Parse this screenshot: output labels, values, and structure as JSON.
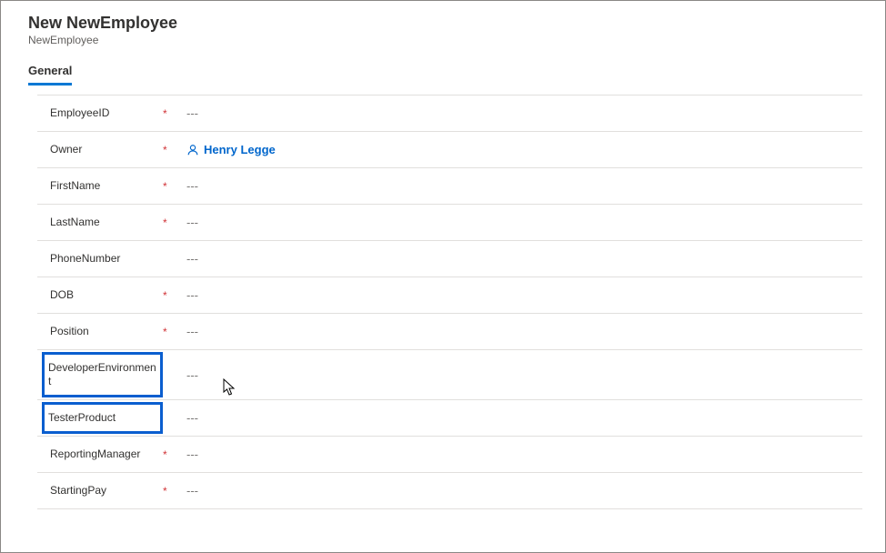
{
  "header": {
    "title": "New NewEmployee",
    "subtitle": "NewEmployee"
  },
  "tabs": {
    "general": "General"
  },
  "fields": [
    {
      "id": "employee-id",
      "label": "EmployeeID",
      "required": true,
      "value": "---",
      "highlight": false
    },
    {
      "id": "owner",
      "label": "Owner",
      "required": true,
      "value": "Henry Legge",
      "highlight": false,
      "type": "person"
    },
    {
      "id": "first-name",
      "label": "FirstName",
      "required": true,
      "value": "---",
      "highlight": false
    },
    {
      "id": "last-name",
      "label": "LastName",
      "required": true,
      "value": "---",
      "highlight": false
    },
    {
      "id": "phone-number",
      "label": "PhoneNumber",
      "required": false,
      "value": "---",
      "highlight": false
    },
    {
      "id": "dob",
      "label": "DOB",
      "required": true,
      "value": "---",
      "highlight": false
    },
    {
      "id": "position",
      "label": "Position",
      "required": true,
      "value": "---",
      "highlight": false
    },
    {
      "id": "developer-env",
      "label": "DeveloperEnvironment",
      "required": false,
      "value": "---",
      "highlight": true
    },
    {
      "id": "tester-product",
      "label": "TesterProduct",
      "required": false,
      "value": "---",
      "highlight": true
    },
    {
      "id": "reporting-manager",
      "label": "ReportingManager",
      "required": true,
      "value": "---",
      "highlight": false
    },
    {
      "id": "starting-pay",
      "label": "StartingPay",
      "required": true,
      "value": "---",
      "highlight": false
    }
  ],
  "required_marker": "*"
}
